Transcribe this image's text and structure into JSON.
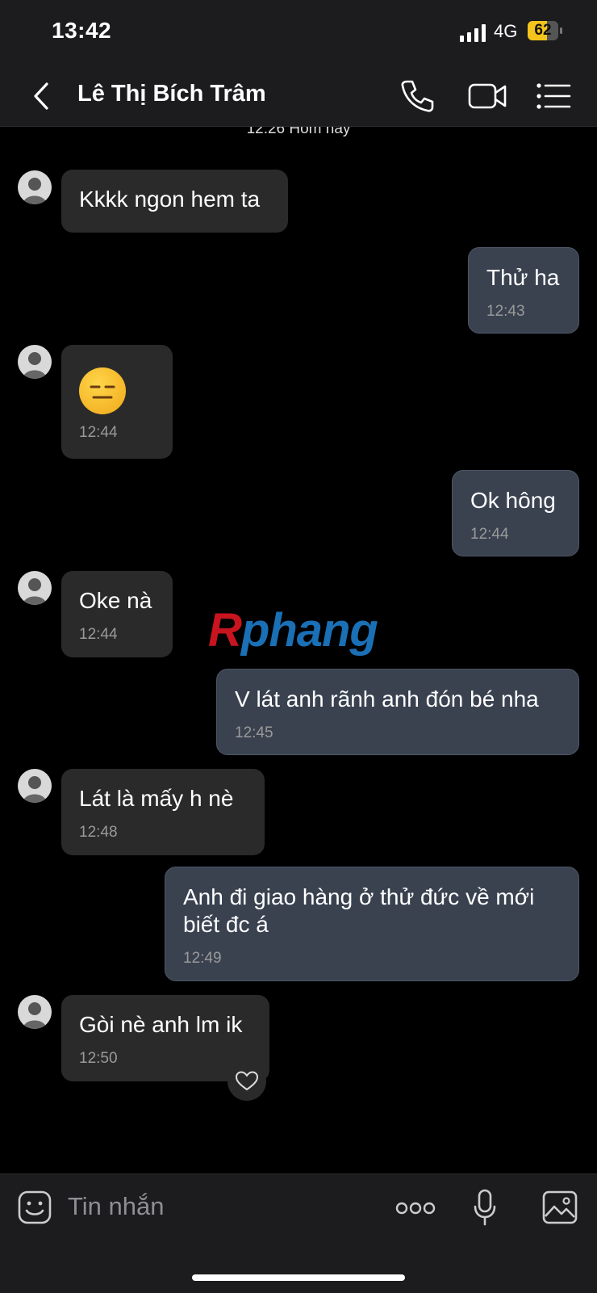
{
  "status_bar": {
    "time": "13:42",
    "network": "4G",
    "battery": "62"
  },
  "header": {
    "contact_name": "Lê Thị Bích Trâm"
  },
  "chat": {
    "date_separator": "12:26 Hôm nay",
    "messages": [
      {
        "side": "in",
        "text": "Kkkk ngon hem ta",
        "time": ""
      },
      {
        "side": "out",
        "text": "Thử ha",
        "time": "12:43"
      },
      {
        "side": "in",
        "text": "",
        "emoji": "expressionless-face",
        "time": "12:44"
      },
      {
        "side": "out",
        "text": "Ok hông",
        "time": "12:44"
      },
      {
        "side": "in",
        "text": "Oke nà",
        "time": "12:44"
      },
      {
        "side": "out",
        "text": "V lát anh rãnh anh đón bé nha",
        "time": "12:45"
      },
      {
        "side": "in",
        "text": "Lát là mấy h nè",
        "time": "12:48"
      },
      {
        "side": "out",
        "text": "Anh đi giao hàng ở thử đức về mới biết đc á",
        "time": "12:49"
      },
      {
        "side": "in",
        "text": "Gòi nè anh lm ik",
        "time": "12:50"
      }
    ],
    "watermark": {
      "part1": "R",
      "part2": "phang"
    }
  },
  "input_bar": {
    "placeholder": "Tin nhắn"
  },
  "colors": {
    "background": "#000000",
    "incoming_bubble": "#2a2a2a",
    "outgoing_bubble": "#3a4250",
    "battery": "#f4c41c"
  }
}
